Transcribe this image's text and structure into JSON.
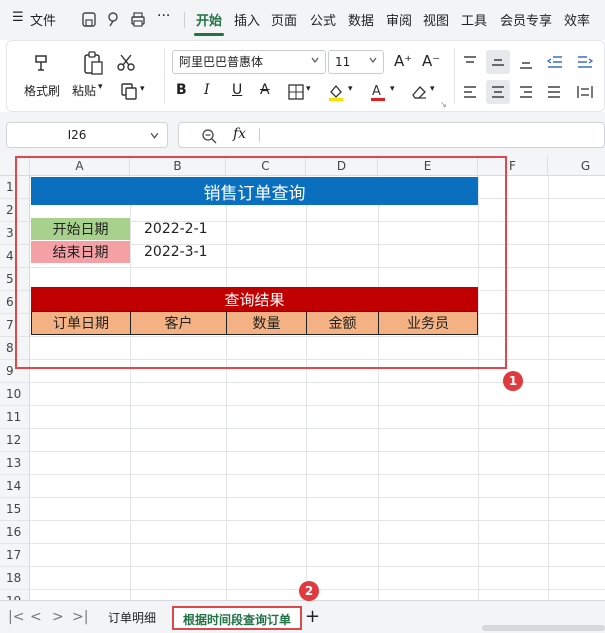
{
  "menubar": {
    "menu_icon": "hamburger-icon",
    "file_label": "文件",
    "tabs": [
      "开始",
      "插入",
      "页面",
      "公式",
      "数据",
      "审阅",
      "视图",
      "工具",
      "会员专享",
      "效率"
    ],
    "active_tab": "开始",
    "more_label": "···"
  },
  "ribbon": {
    "format_painter": "格式刷",
    "paste": "粘贴",
    "font_name": "阿里巴巴普惠体",
    "font_size": "11",
    "font_color": "#e02020",
    "highlight_color": "#f5e400"
  },
  "formulabar": {
    "cell_ref": "I26",
    "fx_label": "fx"
  },
  "grid": {
    "columns": [
      "A",
      "B",
      "C",
      "D",
      "E",
      "F",
      "G"
    ],
    "rows": [
      "1",
      "2",
      "3",
      "4",
      "5",
      "6",
      "7",
      "8",
      "9",
      "10",
      "11",
      "12",
      "13",
      "14",
      "15",
      "16",
      "17",
      "18",
      "19"
    ]
  },
  "sheet": {
    "title": "销售订单查询",
    "start_label": "开始日期",
    "start_value": "2022-2-1",
    "end_label": "结束日期",
    "end_value": "2022-3-1",
    "result_title": "查询结果",
    "headers": [
      "订单日期",
      "客户",
      "数量",
      "金额",
      "业务员"
    ],
    "title_color": "#0b6fc0",
    "result_color": "#c00000",
    "header_color": "#f4b183"
  },
  "annotations": {
    "badge1": "1",
    "badge2": "2"
  },
  "tabs": {
    "sheet1": "订单明细",
    "sheet2": "根据时间段查询订单",
    "add": "+"
  }
}
